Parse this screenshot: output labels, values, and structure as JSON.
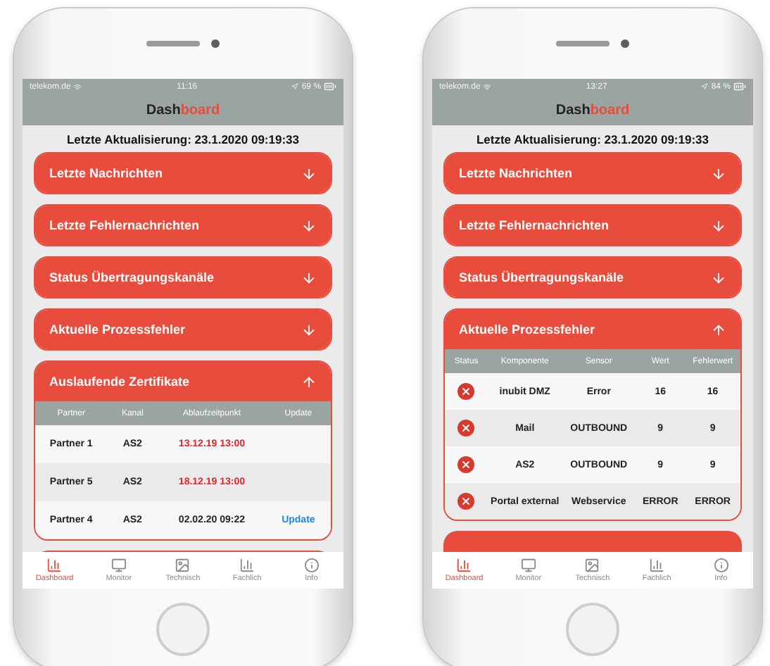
{
  "phones": [
    {
      "status_bar": {
        "carrier": "telekom.de",
        "time": "11:16",
        "battery": "69 %"
      },
      "header": {
        "title_dark": "Dash",
        "title_accent": "board"
      },
      "last_update": "Letzte Aktualisierung: 23.1.2020 09:19:33",
      "sections": [
        {
          "title": "Letzte Nachrichten",
          "expanded": false
        },
        {
          "title": "Letzte Fehlernachrichten",
          "expanded": false
        },
        {
          "title": "Status Übertragungskanäle",
          "expanded": false
        },
        {
          "title": "Aktuelle Prozessfehler",
          "expanded": false
        },
        {
          "title": "Auslaufende Zertifikate",
          "expanded": true,
          "table": {
            "kind": "certificates",
            "columns": [
              "Partner",
              "Kanal",
              "Ablaufzeitpunkt",
              "Update"
            ],
            "rows": [
              {
                "cells": [
                  "Partner 1",
                  "AS2",
                  "13.12.19 13:00"
                ],
                "expired": true
              },
              {
                "cells": [
                  "Partner 5",
                  "AS2",
                  "18.12.19 13:00"
                ],
                "expired": true
              },
              {
                "cells": [
                  "Partner 4",
                  "AS2",
                  "02.02.20 09:22"
                ],
                "expired": false,
                "action": "Update"
              }
            ]
          }
        }
      ],
      "tab_bar": [
        {
          "label": "Dashboard",
          "selected": true
        },
        {
          "label": "Monitor",
          "selected": false
        },
        {
          "label": "Technisch",
          "selected": false
        },
        {
          "label": "Fachlich",
          "selected": false
        },
        {
          "label": "Info",
          "selected": false
        }
      ]
    },
    {
      "status_bar": {
        "carrier": "telekom.de",
        "time": "13:27",
        "battery": "84 %"
      },
      "header": {
        "title_dark": "Dash",
        "title_accent": "board"
      },
      "last_update": "Letzte Aktualisierung: 23.1.2020 09:19:33",
      "sections": [
        {
          "title": "Letzte Nachrichten",
          "expanded": false
        },
        {
          "title": "Letzte Fehlernachrichten",
          "expanded": false
        },
        {
          "title": "Status Übertragungskanäle",
          "expanded": false
        },
        {
          "title": "Aktuelle Prozessfehler",
          "expanded": true,
          "table": {
            "kind": "errors",
            "status_column": "Status",
            "columns": [
              "Komponente",
              "Sensor",
              "Wert",
              "Fehlerwert"
            ],
            "rows": [
              {
                "kind": "error",
                "cells": [
                  "inubit DMZ",
                  "Error",
                  "16",
                  "16"
                ]
              },
              {
                "kind": "error",
                "cells": [
                  "Mail",
                  "OUTBOUND",
                  "9",
                  "9"
                ]
              },
              {
                "kind": "error",
                "cells": [
                  "AS2",
                  "OUTBOUND",
                  "9",
                  "9"
                ]
              },
              {
                "kind": "error",
                "cells": [
                  "Portal external",
                  "Webservice",
                  "ERROR",
                  "ERROR"
                ]
              }
            ]
          }
        }
      ],
      "tab_bar": [
        {
          "label": "Dashboard",
          "selected": true
        },
        {
          "label": "Monitor",
          "selected": false
        },
        {
          "label": "Technisch",
          "selected": false
        },
        {
          "label": "Fachlich",
          "selected": false
        },
        {
          "label": "Info",
          "selected": false
        }
      ]
    }
  ]
}
